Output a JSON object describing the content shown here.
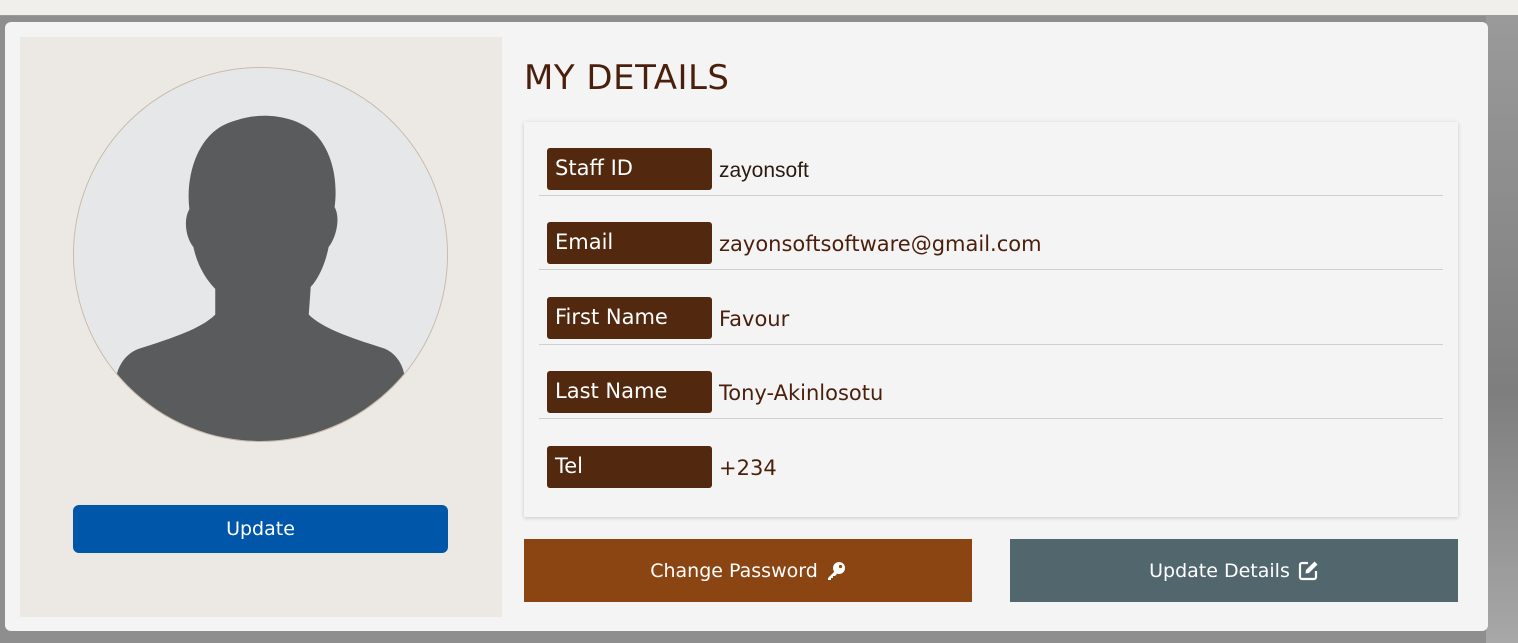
{
  "section_title": "MY DETAILS",
  "profile": {
    "update_label": "Update",
    "avatar_icon": "person-silhouette-icon"
  },
  "details": [
    {
      "label": "Staff ID",
      "value": "zayonsoft"
    },
    {
      "label": "Email",
      "value": "zayonsoftsoftware@gmail.com"
    },
    {
      "label": "First Name",
      "value": "Favour"
    },
    {
      "label": "Last Name",
      "value": "Tony-Akinlosotu"
    },
    {
      "label": "Tel",
      "value": "+234"
    }
  ],
  "actions": {
    "change_password_label": "Change Password",
    "change_password_icon": "key-icon",
    "update_details_label": "Update Details",
    "update_details_icon": "edit-icon"
  },
  "colors": {
    "label_bg": "#52290e",
    "update_button": "#0056a8",
    "change_password_button": "#8b4513",
    "update_details_button": "#52666e",
    "title_text": "#4a1f0c"
  }
}
